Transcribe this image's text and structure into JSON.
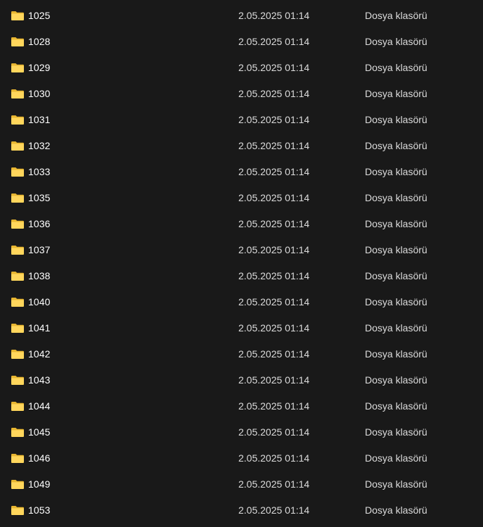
{
  "rows": [
    {
      "name": "1025",
      "date": "2.05.2025 01:14",
      "type": "Dosya klasörü",
      "icon": "folder-icon"
    },
    {
      "name": "1028",
      "date": "2.05.2025 01:14",
      "type": "Dosya klasörü",
      "icon": "folder-icon"
    },
    {
      "name": "1029",
      "date": "2.05.2025 01:14",
      "type": "Dosya klasörü",
      "icon": "folder-icon"
    },
    {
      "name": "1030",
      "date": "2.05.2025 01:14",
      "type": "Dosya klasörü",
      "icon": "folder-icon"
    },
    {
      "name": "1031",
      "date": "2.05.2025 01:14",
      "type": "Dosya klasörü",
      "icon": "folder-icon"
    },
    {
      "name": "1032",
      "date": "2.05.2025 01:14",
      "type": "Dosya klasörü",
      "icon": "folder-icon"
    },
    {
      "name": "1033",
      "date": "2.05.2025 01:14",
      "type": "Dosya klasörü",
      "icon": "folder-icon"
    },
    {
      "name": "1035",
      "date": "2.05.2025 01:14",
      "type": "Dosya klasörü",
      "icon": "folder-icon"
    },
    {
      "name": "1036",
      "date": "2.05.2025 01:14",
      "type": "Dosya klasörü",
      "icon": "folder-icon"
    },
    {
      "name": "1037",
      "date": "2.05.2025 01:14",
      "type": "Dosya klasörü",
      "icon": "folder-icon"
    },
    {
      "name": "1038",
      "date": "2.05.2025 01:14",
      "type": "Dosya klasörü",
      "icon": "folder-icon"
    },
    {
      "name": "1040",
      "date": "2.05.2025 01:14",
      "type": "Dosya klasörü",
      "icon": "folder-icon"
    },
    {
      "name": "1041",
      "date": "2.05.2025 01:14",
      "type": "Dosya klasörü",
      "icon": "folder-icon"
    },
    {
      "name": "1042",
      "date": "2.05.2025 01:14",
      "type": "Dosya klasörü",
      "icon": "folder-icon"
    },
    {
      "name": "1043",
      "date": "2.05.2025 01:14",
      "type": "Dosya klasörü",
      "icon": "folder-icon"
    },
    {
      "name": "1044",
      "date": "2.05.2025 01:14",
      "type": "Dosya klasörü",
      "icon": "folder-icon"
    },
    {
      "name": "1045",
      "date": "2.05.2025 01:14",
      "type": "Dosya klasörü",
      "icon": "folder-icon"
    },
    {
      "name": "1046",
      "date": "2.05.2025 01:14",
      "type": "Dosya klasörü",
      "icon": "folder-icon"
    },
    {
      "name": "1049",
      "date": "2.05.2025 01:14",
      "type": "Dosya klasörü",
      "icon": "folder-icon"
    },
    {
      "name": "1053",
      "date": "2.05.2025 01:14",
      "type": "Dosya klasörü",
      "icon": "folder-icon"
    }
  ],
  "colors": {
    "background": "#191919",
    "name_text": "#ffffff",
    "detail_text": "#dcdcdc",
    "folder_front": "#ffd65c",
    "folder_back": "#e8b631"
  }
}
